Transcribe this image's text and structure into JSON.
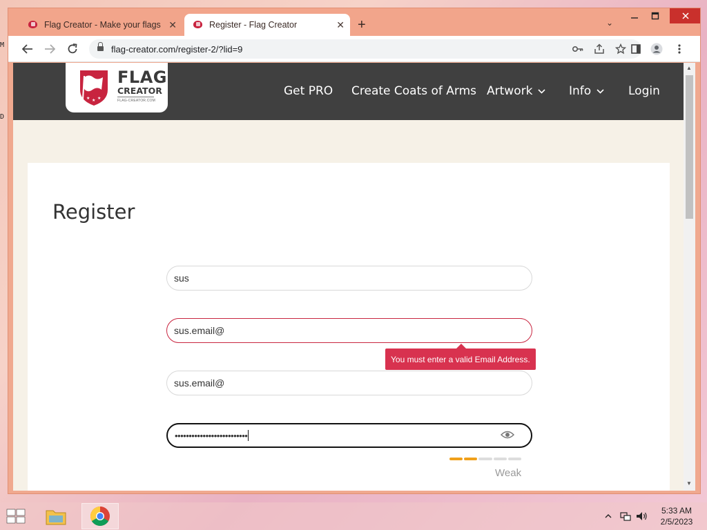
{
  "desktop": {
    "marks": [
      "M",
      "D"
    ]
  },
  "browser": {
    "tabs": [
      {
        "title": "Flag Creator - Make your flags",
        "active": false
      },
      {
        "title": "Register - Flag Creator",
        "active": true
      }
    ],
    "new_tab_symbol": "+",
    "tab_close_symbol": "✕",
    "url": "flag-creator.com/register-2/?lid=9",
    "window_controls": {
      "minimize": "🗕",
      "maximize": "🗖",
      "close": "✕"
    }
  },
  "site": {
    "logo": {
      "line1": "FLAG",
      "line2": "CREATOR",
      "line3": "FLAG-CREATOR.COM"
    },
    "nav": [
      {
        "label": "Get PRO",
        "dropdown": false
      },
      {
        "label": "Create Coats of Arms",
        "dropdown": false
      },
      {
        "label": "Artwork",
        "dropdown": true
      },
      {
        "label": "Info",
        "dropdown": true
      },
      {
        "label": "Login",
        "dropdown": false
      }
    ]
  },
  "form": {
    "title": "Register",
    "username": "sus",
    "email": "sus.email@",
    "email_confirm": "sus.email@",
    "password_mask": "••••••••••••••••••••••••••",
    "email_error": "You must enter a valid Email Address.",
    "password_strength": {
      "label": "Weak",
      "level": 2,
      "max": 5
    }
  },
  "colors": {
    "brand_red": "#c8243f",
    "header_bg": "#404040",
    "strength_on": "#f0a01a"
  },
  "taskbar": {
    "time": "5:33 AM",
    "date": "2/5/2023",
    "apps": [
      "file-explorer",
      "chrome"
    ]
  }
}
